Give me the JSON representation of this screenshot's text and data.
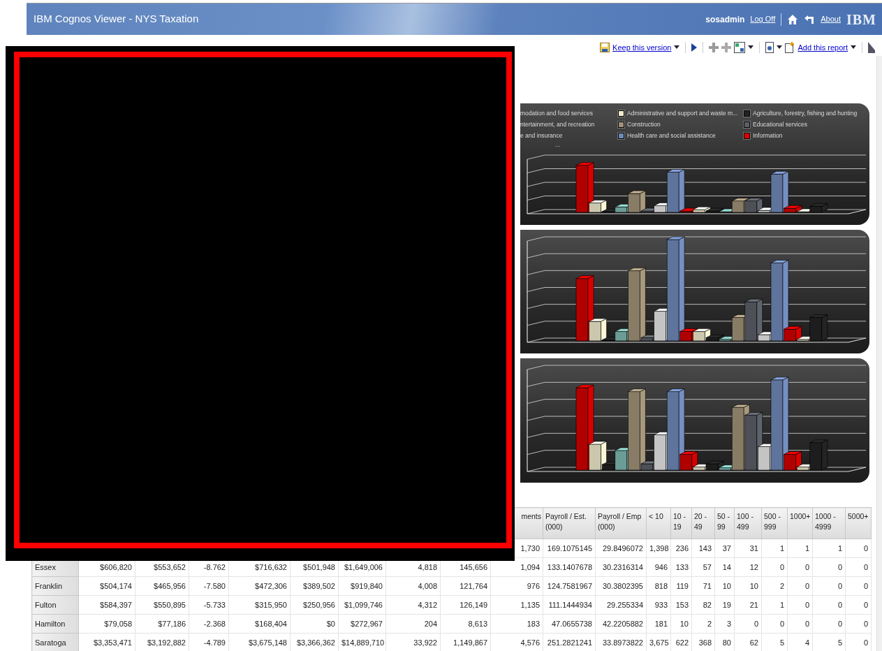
{
  "window": {
    "title": "IBM Cognos Viewer - NYS Taxation"
  },
  "header": {
    "user": "sosadmin",
    "log_off": "Log Off",
    "about": "About",
    "logo": "IBM"
  },
  "toolbar": {
    "keep_version": "Keep this version",
    "add_report": "Add this report"
  },
  "charts": [
    {
      "kind": "with-legend",
      "legend_more": "...",
      "legend": [
        {
          "label": "modation and food services"
        },
        {
          "label": "ntertainment, and recreation"
        },
        {
          "label": "e and insurance"
        },
        {
          "label": "Administrative and support and waste m...",
          "color": "#eeeacc"
        },
        {
          "label": "Construction",
          "color": "#a09278"
        },
        {
          "label": "Health care and social assistance",
          "color": "#7088b8"
        },
        {
          "label": "Agriculture, forestry, fishing and hunting",
          "color": "#222222"
        },
        {
          "label": "Educational services",
          "color": "#5a5e66"
        },
        {
          "label": "Information",
          "color": "#e00000"
        }
      ]
    },
    {
      "kind": "plain"
    },
    {
      "kind": "plain"
    }
  ],
  "table": {
    "columns": [
      "ments",
      "Payroll / Est. (000)",
      "Payroll / Emp (000)",
      "< 10",
      "10 - 19",
      "20 - 49",
      "50 - 99",
      "100 - 499",
      "500 - 999",
      "1000+",
      "1000 - 4999",
      "5000+"
    ],
    "rows": [
      {
        "cells": [
          "1,730",
          "169.1075145",
          "29.8496072",
          "1,398",
          "236",
          "143",
          "37",
          "31",
          "1",
          "1",
          "1",
          "0"
        ]
      },
      {
        "name": "Essex",
        "cells": [
          "$606,820",
          "$553,652",
          "-8.762",
          "$716,632",
          "$501,948",
          "$1,649,006",
          "4,818",
          "145,656",
          "1,094",
          "133.1407678",
          "30.2316314",
          "946",
          "133",
          "57",
          "14",
          "12",
          "0",
          "0",
          "0",
          "0"
        ]
      },
      {
        "name": "Franklin",
        "cells": [
          "$504,174",
          "$465,956",
          "-7.580",
          "$472,306",
          "$389,502",
          "$919,840",
          "4,008",
          "121,764",
          "976",
          "124.7581967",
          "30.3802395",
          "818",
          "119",
          "71",
          "10",
          "10",
          "2",
          "0",
          "0",
          "0"
        ]
      },
      {
        "name": "Fulton",
        "cells": [
          "$584,397",
          "$550,895",
          "-5.733",
          "$315,950",
          "$250,956",
          "$1,099,746",
          "4,312",
          "126,149",
          "1,135",
          "111.1444934",
          "29.255334",
          "933",
          "153",
          "82",
          "19",
          "21",
          "1",
          "0",
          "0",
          "0"
        ]
      },
      {
        "name": "Hamilton",
        "cells": [
          "$79,058",
          "$77,186",
          "-2.368",
          "$168,404",
          "$0",
          "$272,967",
          "204",
          "8,613",
          "183",
          "47.0655738",
          "42.2205882",
          "181",
          "10",
          "2",
          "3",
          "0",
          "0",
          "0",
          "0",
          "0"
        ]
      },
      {
        "name": "Saratoga",
        "cells": [
          "$3,353,471",
          "$3,192,882",
          "-4.789",
          "$3,675,148",
          "$3,366,362",
          "$14,889,710",
          "33,922",
          "1,149,867",
          "4,576",
          "251.2821241",
          "33.8973822",
          "3,675",
          "622",
          "368",
          "80",
          "62",
          "5",
          "4",
          "5",
          "0"
        ]
      }
    ]
  }
}
